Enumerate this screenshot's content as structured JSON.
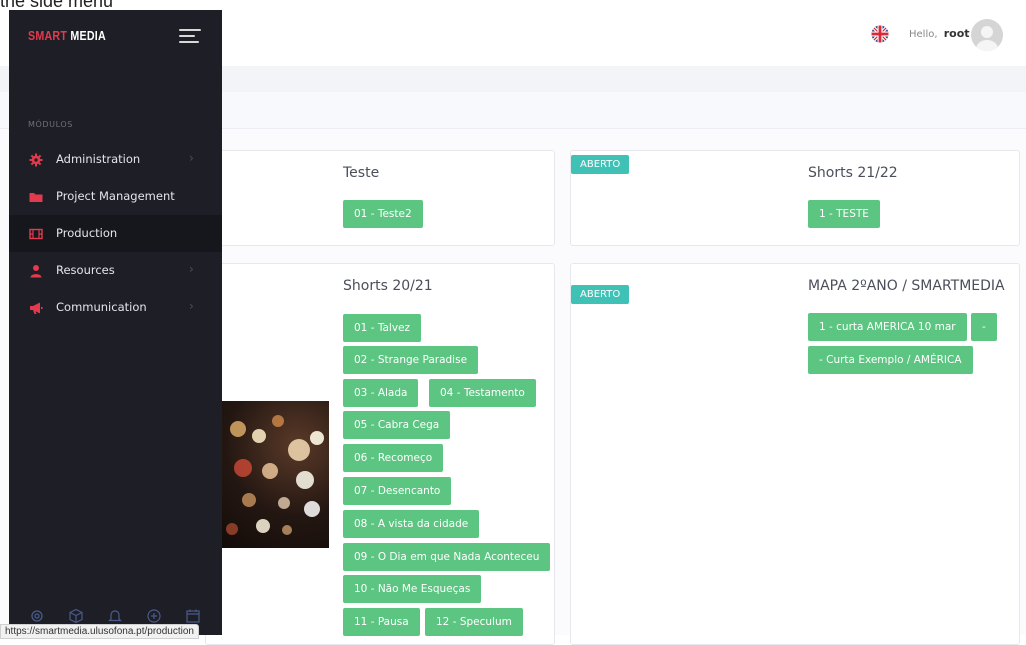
{
  "caption": "the side menu",
  "brand": {
    "part1": "SMART",
    "part2": "MEDIA"
  },
  "header": {
    "hello_prefix": "Hello,",
    "username": "root",
    "flag_icon": "uk-flag-icon"
  },
  "sidebar": {
    "section_label": "MÓDULOS",
    "items": [
      {
        "label": "Administration",
        "icon": "gear-icon",
        "has_submenu": true,
        "active": false
      },
      {
        "label": "Project Management",
        "icon": "folder-icon",
        "has_submenu": false,
        "active": false
      },
      {
        "label": "Production",
        "icon": "film-icon",
        "has_submenu": false,
        "active": true
      },
      {
        "label": "Resources",
        "icon": "user-icon",
        "has_submenu": true,
        "active": false
      },
      {
        "label": "Communication",
        "icon": "megaphone-icon",
        "has_submenu": true,
        "active": false
      }
    ],
    "chevron": "›",
    "bottom_icons": [
      "settings-icon",
      "cube-icon",
      "bell-icon",
      "add-circle-icon",
      "calendar-icon"
    ]
  },
  "cards": {
    "teste": {
      "title": "Teste",
      "tags": [
        "01 - Teste2"
      ]
    },
    "shorts2122": {
      "badge": "ABERTO",
      "title": "Shorts 21/22",
      "tags": [
        "1 - TESTE"
      ]
    },
    "shorts2021": {
      "title": "Shorts 20/21",
      "tags": [
        "01 - Talvez",
        "02 - Strange Paradise",
        "03 - Alada",
        "04 - Testamento",
        "05 - Cabra Cega",
        "06 - Recomeço",
        "07 - Desencanto",
        "08 - A vista da cidade",
        "09 - O Dia em que Nada Aconteceu",
        "10 - Não Me Esqueças",
        "11 - Pausa",
        "12 - Speculum"
      ]
    },
    "mapa": {
      "badge": "ABERTO",
      "title": "MAPA 2ºANO / SMARTMEDIA",
      "tags": [
        "1 - curta AMERICA 10 mar",
        "-",
        "- Curta Exemplo / AMÉRICA"
      ]
    }
  },
  "colors": {
    "sidebar_bg": "#1e1f26",
    "accent_red": "#e33a4e",
    "tag_green": "#5cc581",
    "badge_teal": "#3fc2b5"
  },
  "status_bar": {
    "url": "https://smartmedia.ulusofona.pt/production"
  }
}
